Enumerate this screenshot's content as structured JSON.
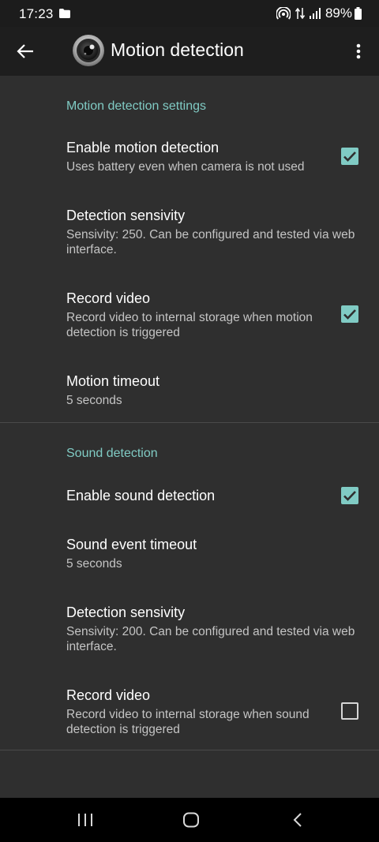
{
  "status_bar": {
    "time": "17:23",
    "battery_percent": "89%",
    "icons": [
      "folder-icon",
      "hotspot-icon",
      "data-arrows-icon",
      "signal-icon",
      "battery-icon"
    ]
  },
  "app_bar": {
    "title": "Motion detection",
    "icons": [
      "back-arrow-icon",
      "camera-lens-icon",
      "overflow-menu-icon"
    ]
  },
  "sections": {
    "motion": {
      "header": "Motion detection settings",
      "items": [
        {
          "title": "Enable motion detection",
          "summary": "Uses battery even when camera is not used",
          "checked": true
        },
        {
          "title": "Detection sensivity",
          "summary": "Sensivity: 250. Can be configured and tested via web interface."
        },
        {
          "title": "Record video",
          "summary": "Record video to internal storage when motion detection is triggered",
          "checked": true
        },
        {
          "title": "Motion timeout",
          "summary": "5 seconds"
        }
      ]
    },
    "sound": {
      "header": "Sound detection",
      "items": [
        {
          "title": "Enable sound detection",
          "checked": true
        },
        {
          "title": "Sound event timeout",
          "summary": "5 seconds"
        },
        {
          "title": "Detection sensivity",
          "summary": "Sensivity: 200. Can be configured and tested via web interface."
        },
        {
          "title": "Record video",
          "summary": "Record video to internal storage when sound detection is triggered",
          "checked": false
        }
      ]
    }
  },
  "colors": {
    "accent": "#80cbc4",
    "background": "#2f2f2f",
    "app_bar": "#1e1e1e",
    "status_bar": "#1c1c1c",
    "nav_bar": "#000000"
  },
  "nav_bar": {
    "icons": [
      "recent-apps-icon",
      "home-icon",
      "back-icon"
    ]
  }
}
